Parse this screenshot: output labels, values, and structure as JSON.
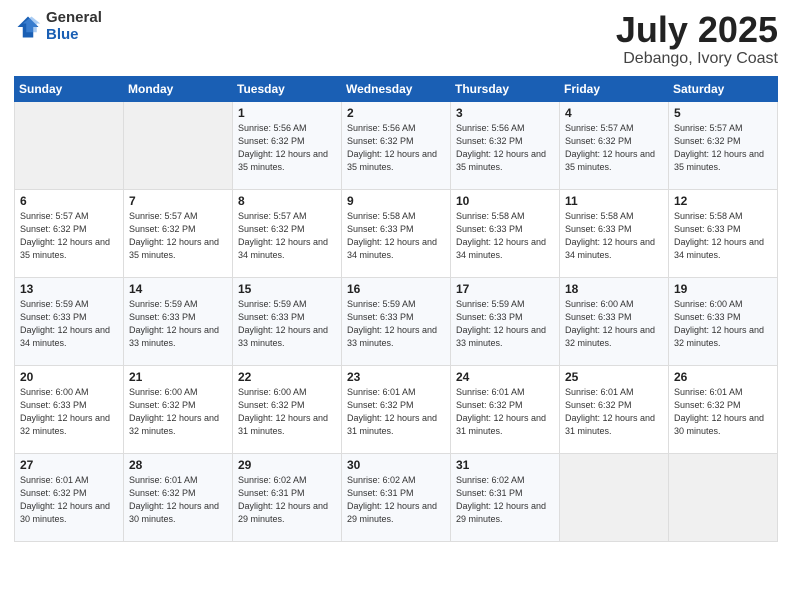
{
  "logo": {
    "general": "General",
    "blue": "Blue"
  },
  "title": "July 2025",
  "location": "Debango, Ivory Coast",
  "days_of_week": [
    "Sunday",
    "Monday",
    "Tuesday",
    "Wednesday",
    "Thursday",
    "Friday",
    "Saturday"
  ],
  "weeks": [
    [
      {
        "day": "",
        "info": ""
      },
      {
        "day": "",
        "info": ""
      },
      {
        "day": "1",
        "info": "Sunrise: 5:56 AM\nSunset: 6:32 PM\nDaylight: 12 hours and 35 minutes."
      },
      {
        "day": "2",
        "info": "Sunrise: 5:56 AM\nSunset: 6:32 PM\nDaylight: 12 hours and 35 minutes."
      },
      {
        "day": "3",
        "info": "Sunrise: 5:56 AM\nSunset: 6:32 PM\nDaylight: 12 hours and 35 minutes."
      },
      {
        "day": "4",
        "info": "Sunrise: 5:57 AM\nSunset: 6:32 PM\nDaylight: 12 hours and 35 minutes."
      },
      {
        "day": "5",
        "info": "Sunrise: 5:57 AM\nSunset: 6:32 PM\nDaylight: 12 hours and 35 minutes."
      }
    ],
    [
      {
        "day": "6",
        "info": "Sunrise: 5:57 AM\nSunset: 6:32 PM\nDaylight: 12 hours and 35 minutes."
      },
      {
        "day": "7",
        "info": "Sunrise: 5:57 AM\nSunset: 6:32 PM\nDaylight: 12 hours and 35 minutes."
      },
      {
        "day": "8",
        "info": "Sunrise: 5:57 AM\nSunset: 6:32 PM\nDaylight: 12 hours and 34 minutes."
      },
      {
        "day": "9",
        "info": "Sunrise: 5:58 AM\nSunset: 6:33 PM\nDaylight: 12 hours and 34 minutes."
      },
      {
        "day": "10",
        "info": "Sunrise: 5:58 AM\nSunset: 6:33 PM\nDaylight: 12 hours and 34 minutes."
      },
      {
        "day": "11",
        "info": "Sunrise: 5:58 AM\nSunset: 6:33 PM\nDaylight: 12 hours and 34 minutes."
      },
      {
        "day": "12",
        "info": "Sunrise: 5:58 AM\nSunset: 6:33 PM\nDaylight: 12 hours and 34 minutes."
      }
    ],
    [
      {
        "day": "13",
        "info": "Sunrise: 5:59 AM\nSunset: 6:33 PM\nDaylight: 12 hours and 34 minutes."
      },
      {
        "day": "14",
        "info": "Sunrise: 5:59 AM\nSunset: 6:33 PM\nDaylight: 12 hours and 33 minutes."
      },
      {
        "day": "15",
        "info": "Sunrise: 5:59 AM\nSunset: 6:33 PM\nDaylight: 12 hours and 33 minutes."
      },
      {
        "day": "16",
        "info": "Sunrise: 5:59 AM\nSunset: 6:33 PM\nDaylight: 12 hours and 33 minutes."
      },
      {
        "day": "17",
        "info": "Sunrise: 5:59 AM\nSunset: 6:33 PM\nDaylight: 12 hours and 33 minutes."
      },
      {
        "day": "18",
        "info": "Sunrise: 6:00 AM\nSunset: 6:33 PM\nDaylight: 12 hours and 32 minutes."
      },
      {
        "day": "19",
        "info": "Sunrise: 6:00 AM\nSunset: 6:33 PM\nDaylight: 12 hours and 32 minutes."
      }
    ],
    [
      {
        "day": "20",
        "info": "Sunrise: 6:00 AM\nSunset: 6:33 PM\nDaylight: 12 hours and 32 minutes."
      },
      {
        "day": "21",
        "info": "Sunrise: 6:00 AM\nSunset: 6:32 PM\nDaylight: 12 hours and 32 minutes."
      },
      {
        "day": "22",
        "info": "Sunrise: 6:00 AM\nSunset: 6:32 PM\nDaylight: 12 hours and 31 minutes."
      },
      {
        "day": "23",
        "info": "Sunrise: 6:01 AM\nSunset: 6:32 PM\nDaylight: 12 hours and 31 minutes."
      },
      {
        "day": "24",
        "info": "Sunrise: 6:01 AM\nSunset: 6:32 PM\nDaylight: 12 hours and 31 minutes."
      },
      {
        "day": "25",
        "info": "Sunrise: 6:01 AM\nSunset: 6:32 PM\nDaylight: 12 hours and 31 minutes."
      },
      {
        "day": "26",
        "info": "Sunrise: 6:01 AM\nSunset: 6:32 PM\nDaylight: 12 hours and 30 minutes."
      }
    ],
    [
      {
        "day": "27",
        "info": "Sunrise: 6:01 AM\nSunset: 6:32 PM\nDaylight: 12 hours and 30 minutes."
      },
      {
        "day": "28",
        "info": "Sunrise: 6:01 AM\nSunset: 6:32 PM\nDaylight: 12 hours and 30 minutes."
      },
      {
        "day": "29",
        "info": "Sunrise: 6:02 AM\nSunset: 6:31 PM\nDaylight: 12 hours and 29 minutes."
      },
      {
        "day": "30",
        "info": "Sunrise: 6:02 AM\nSunset: 6:31 PM\nDaylight: 12 hours and 29 minutes."
      },
      {
        "day": "31",
        "info": "Sunrise: 6:02 AM\nSunset: 6:31 PM\nDaylight: 12 hours and 29 minutes."
      },
      {
        "day": "",
        "info": ""
      },
      {
        "day": "",
        "info": ""
      }
    ]
  ]
}
